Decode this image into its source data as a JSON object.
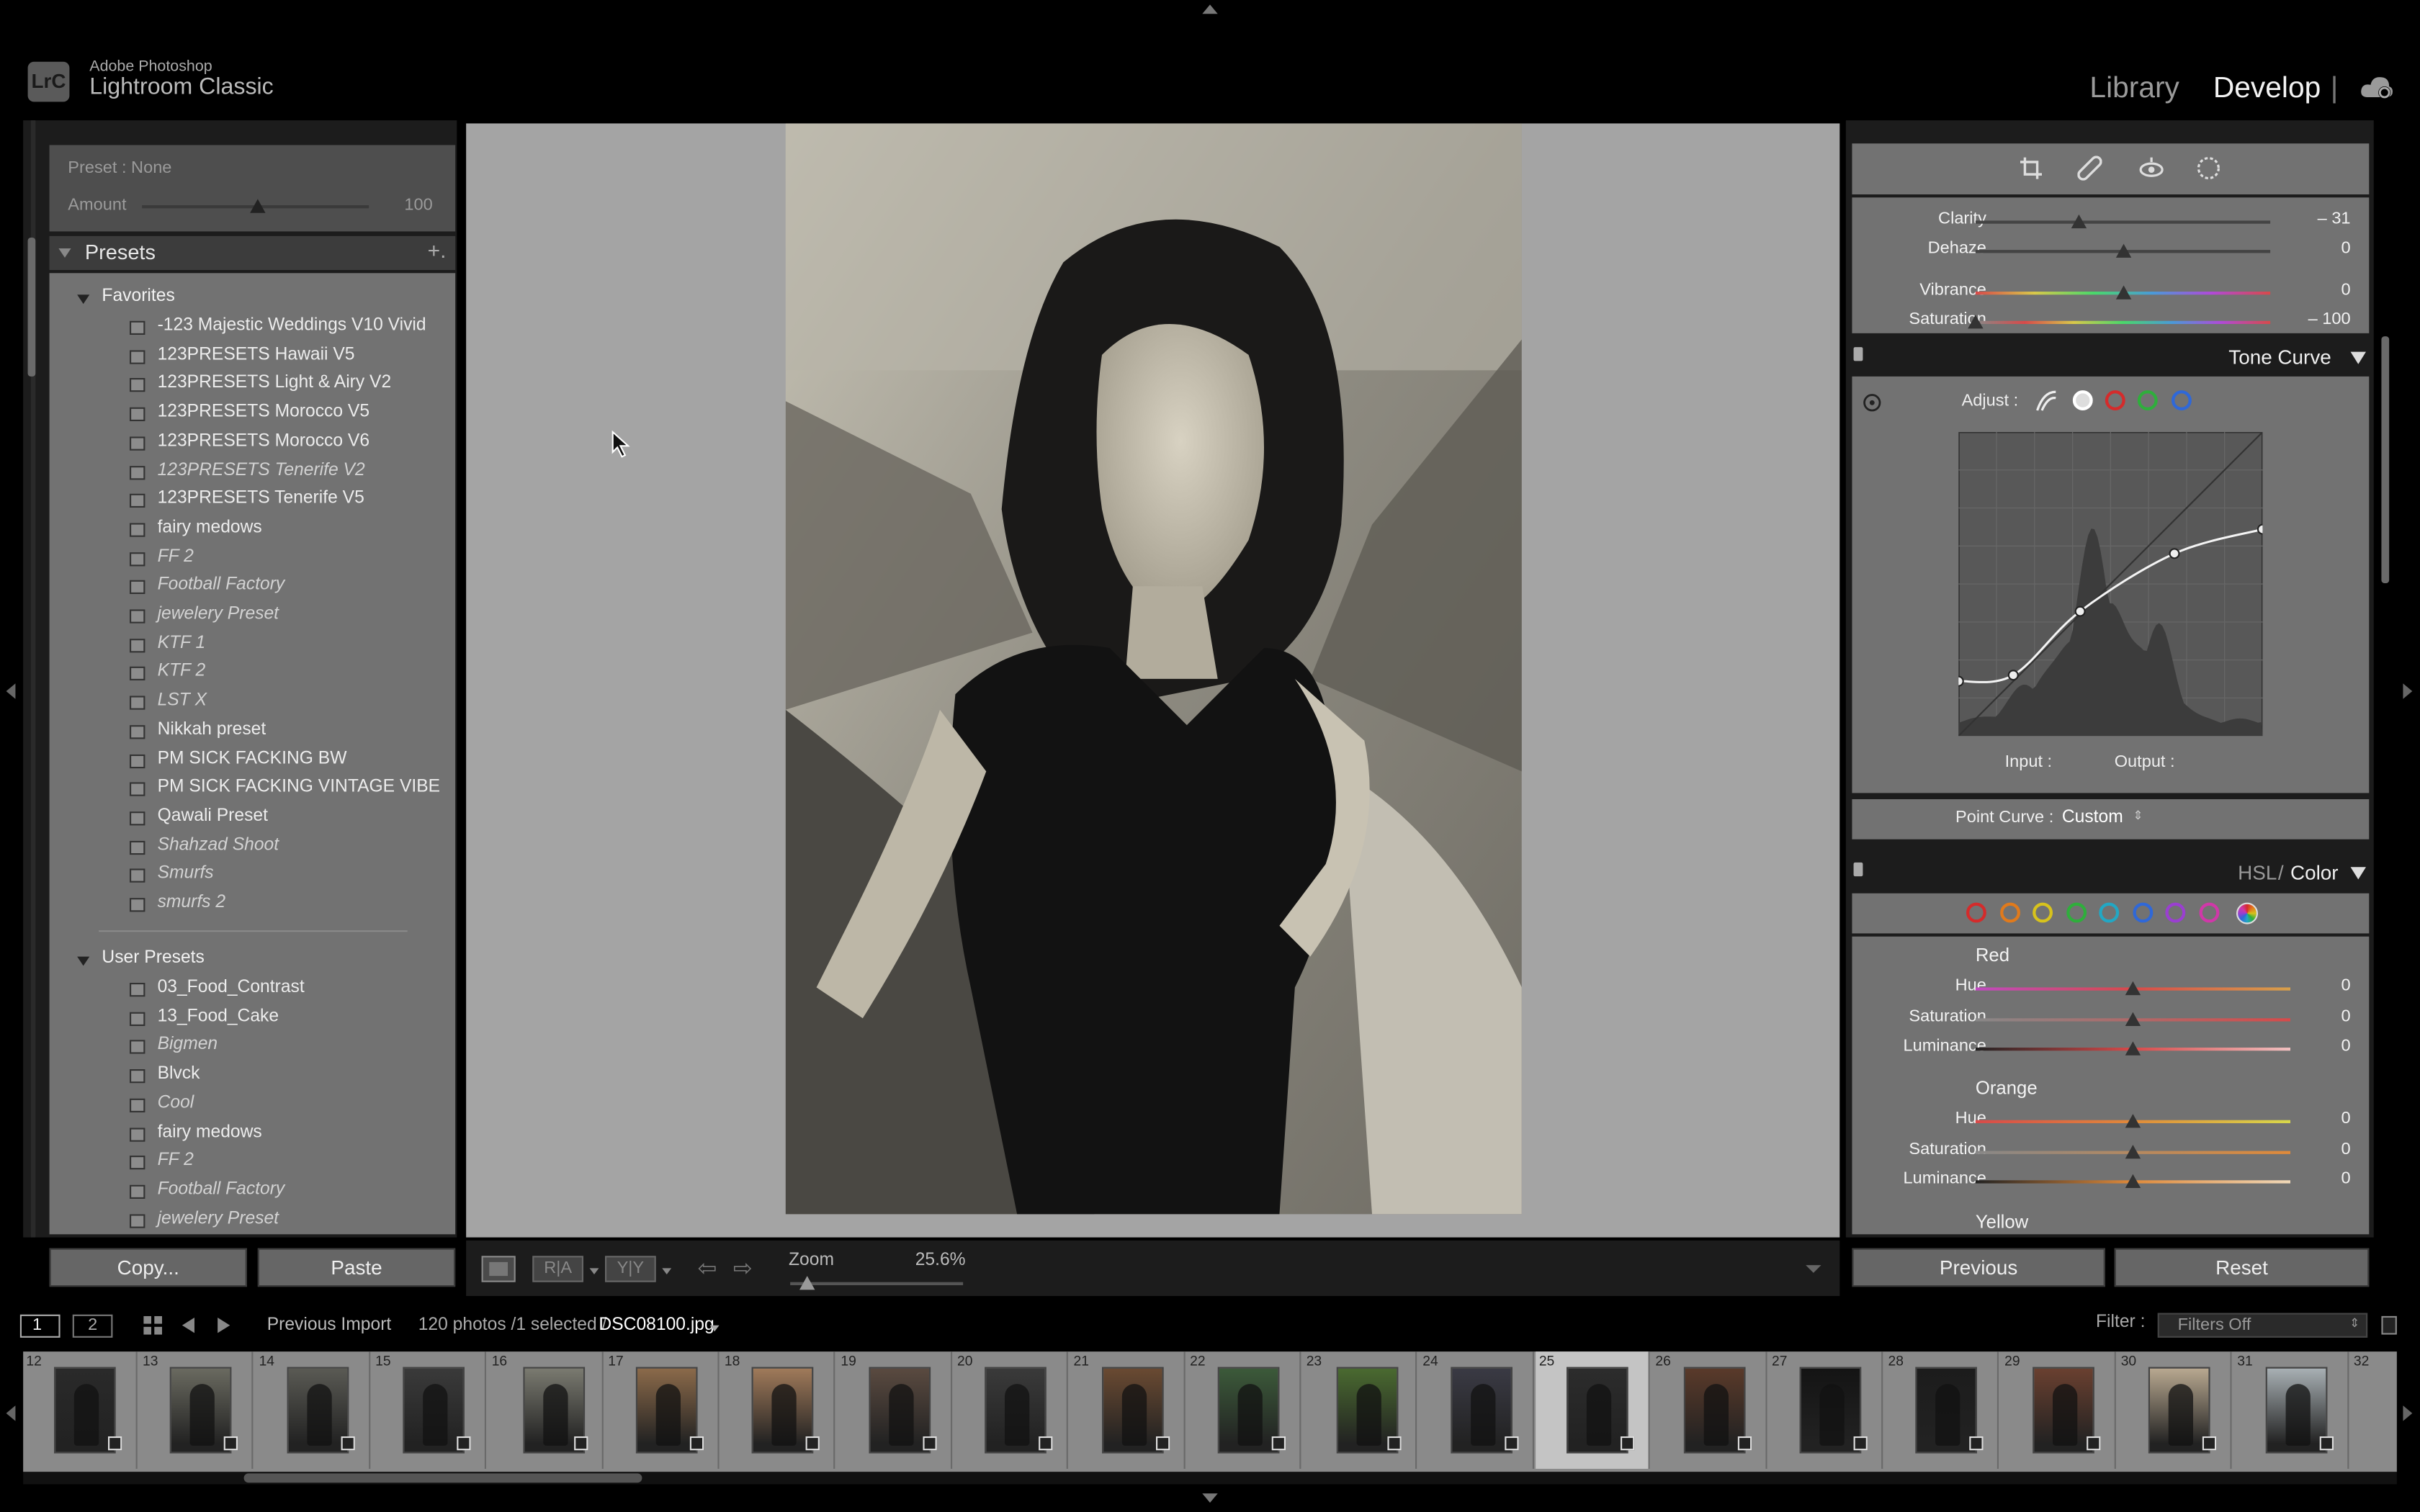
{
  "app": {
    "logo": "LrC",
    "vendor": "Adobe Photoshop",
    "name": "Lightroom Classic"
  },
  "modules": {
    "library": "Library",
    "develop": "Develop",
    "separator": "|"
  },
  "left": {
    "preset_amount": {
      "preset": "Preset : None",
      "amount_label": "Amount",
      "amount_value": "100"
    },
    "presets_title": "Presets",
    "add_symbol": "+.",
    "favorites_title": "Favorites",
    "favorites": [
      {
        "label": "-123 Majestic Weddings V10 Vivid",
        "italic": false
      },
      {
        "label": "123PRESETS Hawaii V5",
        "italic": false
      },
      {
        "label": "123PRESETS Light & Airy V2",
        "italic": false
      },
      {
        "label": "123PRESETS Morocco V5",
        "italic": false
      },
      {
        "label": "123PRESETS Morocco V6",
        "italic": false
      },
      {
        "label": "123PRESETS Tenerife V2",
        "italic": true
      },
      {
        "label": "123PRESETS Tenerife V5",
        "italic": false
      },
      {
        "label": "fairy medows",
        "italic": false
      },
      {
        "label": "FF 2",
        "italic": true
      },
      {
        "label": "Football Factory",
        "italic": true
      },
      {
        "label": "jewelery Preset",
        "italic": true
      },
      {
        "label": "KTF 1",
        "italic": true
      },
      {
        "label": "KTF 2",
        "italic": true
      },
      {
        "label": "LST X",
        "italic": true
      },
      {
        "label": "Nikkah preset",
        "italic": false
      },
      {
        "label": "PM SICK FACKING BW",
        "italic": false
      },
      {
        "label": "PM SICK FACKING VINTAGE VIBE",
        "italic": false
      },
      {
        "label": "Qawali Preset",
        "italic": false
      },
      {
        "label": "Shahzad Shoot",
        "italic": true
      },
      {
        "label": "Smurfs",
        "italic": true
      },
      {
        "label": "smurfs 2",
        "italic": true
      }
    ],
    "user_presets_title": "User Presets",
    "user_presets": [
      {
        "label": "03_Food_Contrast",
        "italic": false
      },
      {
        "label": "13_Food_Cake",
        "italic": false
      },
      {
        "label": "Bigmen",
        "italic": true
      },
      {
        "label": "Blvck",
        "italic": false
      },
      {
        "label": "Cool",
        "italic": true
      },
      {
        "label": "fairy medows",
        "italic": false
      },
      {
        "label": "FF 2",
        "italic": true
      },
      {
        "label": "Football Factory",
        "italic": true
      },
      {
        "label": "jewelery Preset",
        "italic": true
      }
    ],
    "copy_button": "Copy...",
    "paste_button": "Paste"
  },
  "presence": [
    {
      "label": "Clarity",
      "value": "– 31",
      "level": 0.35
    },
    {
      "label": "Dehaze",
      "value": "0",
      "level": 0.5
    },
    {
      "label": "Vibrance",
      "value": "0",
      "level": 0.5
    },
    {
      "label": "Saturation",
      "value": "– 100",
      "level": 0.0
    }
  ],
  "tone_curve": {
    "title": "Tone Curve",
    "adjust_label": "Adjust :",
    "input_label": "Input :",
    "output_label": "Output :",
    "point_curve_label": "Point Curve :",
    "point_curve_value": "Custom",
    "points": [
      [
        0,
        0.18
      ],
      [
        0.18,
        0.2
      ],
      [
        0.4,
        0.41
      ],
      [
        0.71,
        0.6
      ],
      [
        1,
        0.68
      ]
    ]
  },
  "hsl": {
    "title_hsl": "HSL",
    "title_sep": "/",
    "title_color": "Color",
    "swatches": [
      "#d42b2b",
      "#e07a1c",
      "#d7c21c",
      "#2fae3c",
      "#22a7c4",
      "#2f68d8",
      "#9a3fd0",
      "#d038a8"
    ],
    "groups": [
      {
        "name": "Red",
        "rows": [
          {
            "label": "Hue",
            "value": "0"
          },
          {
            "label": "Saturation",
            "value": "0"
          },
          {
            "label": "Luminance",
            "value": "0"
          }
        ]
      },
      {
        "name": "Orange",
        "rows": [
          {
            "label": "Hue",
            "value": "0"
          },
          {
            "label": "Saturation",
            "value": "0"
          },
          {
            "label": "Luminance",
            "value": "0"
          }
        ]
      }
    ],
    "next_group": "Yellow"
  },
  "right_buttons": {
    "previous": "Previous",
    "reset": "Reset"
  },
  "toolbar": {
    "zoom_label": "Zoom",
    "zoom_value": "25.6%",
    "zoom_level": 0.1
  },
  "filmstrip_bar": {
    "screen1": "1",
    "screen2": "2",
    "source": "Previous Import",
    "count": "120 photos /1 selected /",
    "filename": "DSC08100.jpg",
    "filter_label": "Filter :",
    "filter_value": "Filters Off"
  },
  "filmstrip": {
    "numbers": [
      "12",
      "13",
      "14",
      "15",
      "16",
      "17",
      "18",
      "19",
      "20",
      "21",
      "22",
      "23",
      "24",
      "25",
      "26",
      "27",
      "28",
      "29",
      "30",
      "31",
      "32"
    ],
    "selected_index": 13,
    "thumb_tones": [
      "#2a2a2a",
      "#6a6a60",
      "#5a5a54",
      "#3a3a3a",
      "#7a7a70",
      "#8b6a4a",
      "#a07a5a",
      "#5a4a40",
      "#3a3a3a",
      "#6a4a32",
      "#3c5a3a",
      "#4a6a30",
      "#3a3a44",
      "#2c2c2c",
      "#5a3a2a",
      "#141414",
      "#1c1c1c",
      "#6a4030",
      "#b8a890",
      "#a8b0b4"
    ]
  }
}
